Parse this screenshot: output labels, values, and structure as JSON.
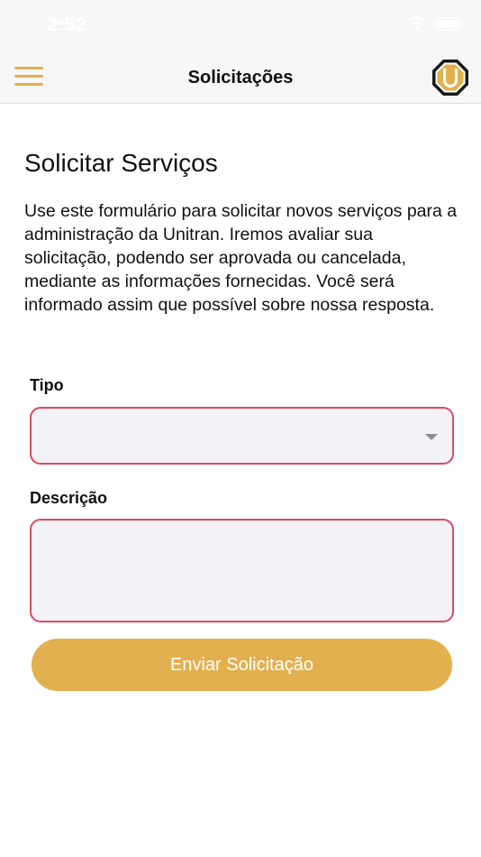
{
  "status_bar": {
    "time": "2:52"
  },
  "header": {
    "title": "Solicitações",
    "menu_icon": "hamburger-menu-icon",
    "logo_icon": "unitran-logo-icon",
    "logo_letter": "U",
    "accent_color": "#e2b04f"
  },
  "main": {
    "title": "Solicitar Serviços",
    "intro": "Use este formulário para solicitar novos serviços para a administração da Unitran. Iremos avaliar sua solicitação, podendo ser aprovada ou cancelada, mediante as informações fornecidas. Você será informado assim que possível sobre nossa resposta.",
    "form": {
      "tipo_label": "Tipo",
      "tipo_value": "",
      "descricao_label": "Descrição",
      "descricao_value": "",
      "error_border_color": "#e0475f",
      "submit_label": "Enviar Solicitação"
    }
  }
}
